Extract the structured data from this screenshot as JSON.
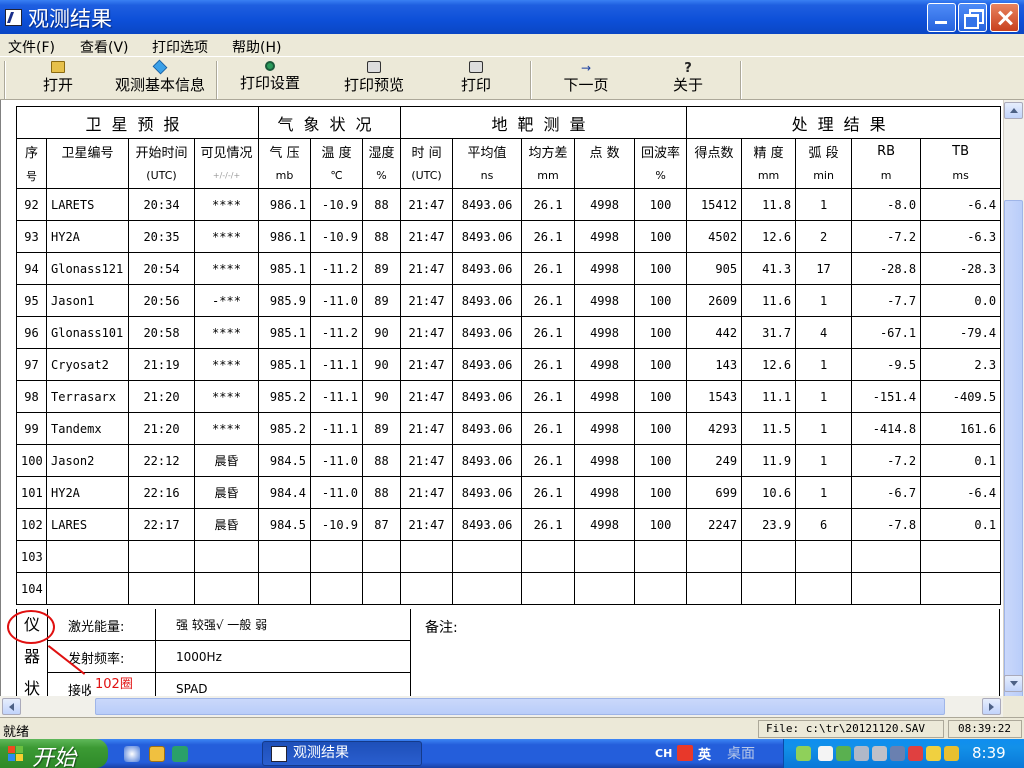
{
  "window": {
    "title": "观测结果"
  },
  "menu": [
    "文件(F)",
    "查看(V)",
    "打印选项",
    "帮助(H)"
  ],
  "toolbar": {
    "open": "打开",
    "info": "观测基本信息",
    "print_setup": "打印设置",
    "print_preview": "打印预览",
    "print": "打印",
    "next_page": "下一页",
    "about": "关于"
  },
  "table": {
    "group_headers": [
      "卫星预报",
      "气象状况",
      "地靶测量",
      "处理结果"
    ],
    "headers": [
      "序",
      "卫星编号",
      "开始时间",
      "可见情况",
      "气 压",
      "温 度",
      "湿度",
      "时 间",
      "平均值",
      "均方差",
      "点 数",
      "回波率",
      "得点数",
      "精 度",
      "弧 段",
      "RB",
      "TB"
    ],
    "units": [
      "号",
      "",
      "(UTC)",
      "+/-/-/+",
      "mb",
      "℃",
      "%",
      "(UTC)",
      "ns",
      "mm",
      "",
      "%",
      "",
      "mm",
      "min",
      "m",
      "ms"
    ],
    "rows": [
      [
        "92",
        "LARETS",
        "20:34",
        "****",
        "986.1",
        "-10.9",
        "88",
        "21:47",
        "8493.06",
        "26.1",
        "4998",
        "100",
        "15412",
        "11.8",
        "1",
        "-8.0",
        "-6.4"
      ],
      [
        "93",
        "HY2A",
        "20:35",
        "****",
        "986.1",
        "-10.9",
        "88",
        "21:47",
        "8493.06",
        "26.1",
        "4998",
        "100",
        "4502",
        "12.6",
        "2",
        "-7.2",
        "-6.3"
      ],
      [
        "94",
        "Glonass121",
        "20:54",
        "****",
        "985.1",
        "-11.2",
        "89",
        "21:47",
        "8493.06",
        "26.1",
        "4998",
        "100",
        "905",
        "41.3",
        "17",
        "-28.8",
        "-28.3"
      ],
      [
        "95",
        "Jason1",
        "20:56",
        "-***",
        "985.9",
        "-11.0",
        "89",
        "21:47",
        "8493.06",
        "26.1",
        "4998",
        "100",
        "2609",
        "11.6",
        "1",
        "-7.7",
        "0.0"
      ],
      [
        "96",
        "Glonass101",
        "20:58",
        "****",
        "985.1",
        "-11.2",
        "90",
        "21:47",
        "8493.06",
        "26.1",
        "4998",
        "100",
        "442",
        "31.7",
        "4",
        "-67.1",
        "-79.4"
      ],
      [
        "97",
        "Cryosat2",
        "21:19",
        "****",
        "985.1",
        "-11.1",
        "90",
        "21:47",
        "8493.06",
        "26.1",
        "4998",
        "100",
        "143",
        "12.6",
        "1",
        "-9.5",
        "2.3"
      ],
      [
        "98",
        "Terrasarx",
        "21:20",
        "****",
        "985.2",
        "-11.1",
        "90",
        "21:47",
        "8493.06",
        "26.1",
        "4998",
        "100",
        "1543",
        "11.1",
        "1",
        "-151.4",
        "-409.5"
      ],
      [
        "99",
        "Tandemx",
        "21:20",
        "****",
        "985.2",
        "-11.1",
        "89",
        "21:47",
        "8493.06",
        "26.1",
        "4998",
        "100",
        "4293",
        "11.5",
        "1",
        "-414.8",
        "161.6"
      ],
      [
        "100",
        "Jason2",
        "22:12",
        "晨昏",
        "984.5",
        "-11.0",
        "88",
        "21:47",
        "8493.06",
        "26.1",
        "4998",
        "100",
        "249",
        "11.9",
        "1",
        "-7.2",
        "0.1"
      ],
      [
        "101",
        "HY2A",
        "22:16",
        "晨昏",
        "984.4",
        "-11.0",
        "88",
        "21:47",
        "8493.06",
        "26.1",
        "4998",
        "100",
        "699",
        "10.6",
        "1",
        "-6.7",
        "-6.4"
      ],
      [
        "102",
        "LARES",
        "22:17",
        "晨昏",
        "984.5",
        "-10.9",
        "87",
        "21:47",
        "8493.06",
        "26.1",
        "4998",
        "100",
        "2247",
        "23.9",
        "6",
        "-7.8",
        "0.1"
      ],
      [
        "103",
        "",
        "",
        "",
        "",
        "",
        "",
        "",
        "",
        "",
        "",
        "",
        "",
        "",
        "",
        "",
        ""
      ],
      [
        "104",
        "",
        "",
        "",
        "",
        "",
        "",
        "",
        "",
        "",
        "",
        "",
        "",
        "",
        "",
        "",
        ""
      ]
    ]
  },
  "instrument": {
    "label": [
      "仪",
      "器",
      "状"
    ],
    "laser_energy_label": "激光能量:",
    "laser_energy_value": "强   较强√  一般   弱",
    "freq_label": "发射频率:",
    "freq_value": "1000Hz",
    "receiver_label": "接收器件:",
    "receiver_value": "SPAD",
    "notes_label": "备注:"
  },
  "annotation": {
    "label": "102圈"
  },
  "status": {
    "ready": "就绪",
    "file": "File: c:\\tr\\20121120.SAV",
    "time": "08:39:22"
  },
  "taskbar": {
    "start": "开始",
    "task": "观测结果",
    "lang": "CH",
    "eng": "英",
    "desktop": "桌面",
    "clock": "8:39"
  },
  "colors": {
    "titlebar": "#0d4fd8",
    "taskbar": "#245edb",
    "start": "#3c9a34",
    "annotation": "#e01010"
  }
}
